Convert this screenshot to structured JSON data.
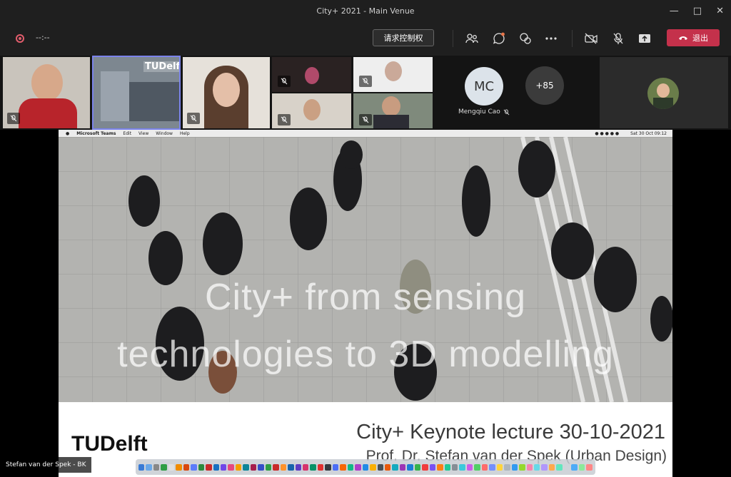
{
  "window": {
    "title": "City+ 2021 - Main Venue"
  },
  "toolbar": {
    "timer": "--:--",
    "request_control_label": "请求控制权",
    "leave_label": "退出"
  },
  "participants": {
    "mc_initials": "MC",
    "mc_name": "Mengqiu Cao",
    "more_count": "+85",
    "presenter_name": "Stefan van der Spek - BK"
  },
  "tile_logo": "TUDelft",
  "slide": {
    "mac_app": "Microsoft Teams",
    "mac_menus": [
      "Edit",
      "View",
      "Window",
      "Help"
    ],
    "mac_clock": "Sat 30 Oct  09:12",
    "title_line1": "City+ from sensing",
    "title_line2": "technologies to 3D modelling",
    "subtitle": "City+ Keynote lecture 30-10-2021",
    "author": "Prof. Dr. Stefan van der Spek (Urban Design)",
    "logo_text": "TUDelft"
  },
  "colors": {
    "leave": "#c4314b",
    "bg": "#1f1f1f",
    "accent": "#7b83eb"
  }
}
